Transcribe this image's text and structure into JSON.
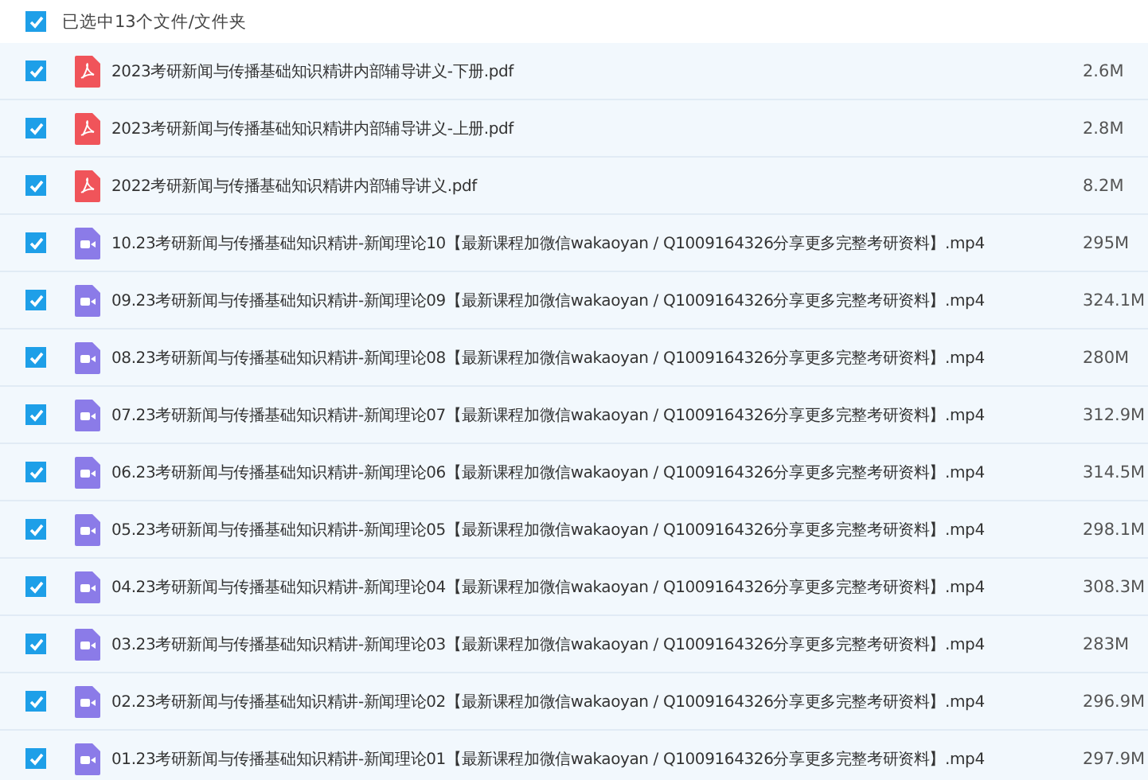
{
  "header": {
    "checked": true,
    "label": "已选中13个文件/文件夹"
  },
  "files": [
    {
      "kind": "pdf",
      "checked": true,
      "name": "2023考研新闻与传播基础知识精讲内部辅导讲义-下册.pdf",
      "size": "2.6M"
    },
    {
      "kind": "pdf",
      "checked": true,
      "name": "2023考研新闻与传播基础知识精讲内部辅导讲义-上册.pdf",
      "size": "2.8M"
    },
    {
      "kind": "pdf",
      "checked": true,
      "name": "2022考研新闻与传播基础知识精讲内部辅导讲义.pdf",
      "size": "8.2M"
    },
    {
      "kind": "video",
      "checked": true,
      "name": "10.23考研新闻与传播基础知识精讲-新闻理论10【最新课程加微信wakaoyan / Q1009164326分享更多完整考研资料】.mp4",
      "size": "295M"
    },
    {
      "kind": "video",
      "checked": true,
      "name": "09.23考研新闻与传播基础知识精讲-新闻理论09【最新课程加微信wakaoyan / Q1009164326分享更多完整考研资料】.mp4",
      "size": "324.1M"
    },
    {
      "kind": "video",
      "checked": true,
      "name": "08.23考研新闻与传播基础知识精讲-新闻理论08【最新课程加微信wakaoyan / Q1009164326分享更多完整考研资料】.mp4",
      "size": "280M"
    },
    {
      "kind": "video",
      "checked": true,
      "name": "07.23考研新闻与传播基础知识精讲-新闻理论07【最新课程加微信wakaoyan / Q1009164326分享更多完整考研资料】.mp4",
      "size": "312.9M"
    },
    {
      "kind": "video",
      "checked": true,
      "name": "06.23考研新闻与传播基础知识精讲-新闻理论06【最新课程加微信wakaoyan / Q1009164326分享更多完整考研资料】.mp4",
      "size": "314.5M"
    },
    {
      "kind": "video",
      "checked": true,
      "name": "05.23考研新闻与传播基础知识精讲-新闻理论05【最新课程加微信wakaoyan / Q1009164326分享更多完整考研资料】.mp4",
      "size": "298.1M"
    },
    {
      "kind": "video",
      "checked": true,
      "name": "04.23考研新闻与传播基础知识精讲-新闻理论04【最新课程加微信wakaoyan / Q1009164326分享更多完整考研资料】.mp4",
      "size": "308.3M"
    },
    {
      "kind": "video",
      "checked": true,
      "name": "03.23考研新闻与传播基础知识精讲-新闻理论03【最新课程加微信wakaoyan / Q1009164326分享更多完整考研资料】.mp4",
      "size": "283M"
    },
    {
      "kind": "video",
      "checked": true,
      "name": "02.23考研新闻与传播基础知识精讲-新闻理论02【最新课程加微信wakaoyan / Q1009164326分享更多完整考研资料】.mp4",
      "size": "296.9M"
    },
    {
      "kind": "video",
      "checked": true,
      "name": "01.23考研新闻与传播基础知识精讲-新闻理论01【最新课程加微信wakaoyan / Q1009164326分享更多完整考研资料】.mp4",
      "size": "297.9M"
    }
  ]
}
